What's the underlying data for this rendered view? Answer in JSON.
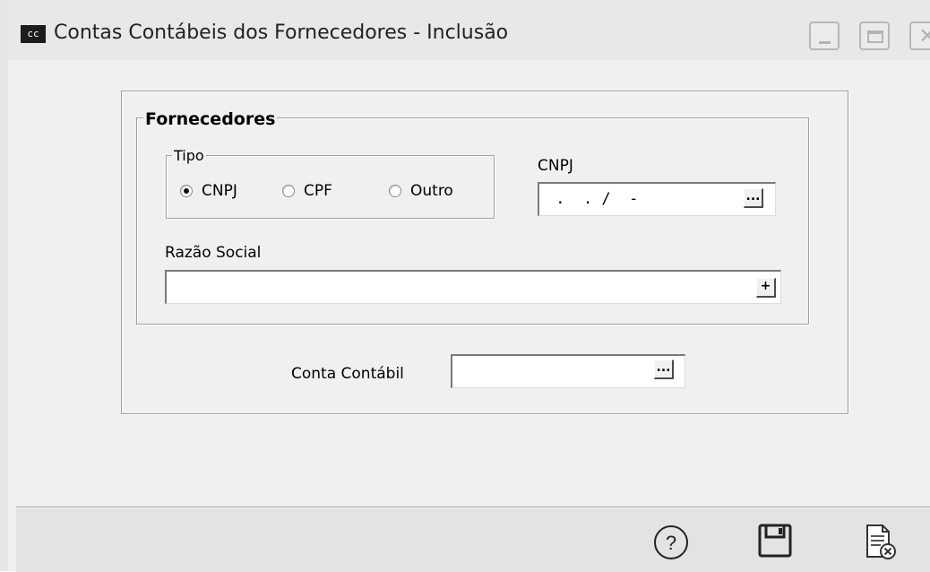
{
  "window": {
    "icon_text": "cc",
    "title": "Contas Contábeis dos Fornecedores - Inclusão"
  },
  "form": {
    "group_title": "Fornecedores",
    "tipo": {
      "title": "Tipo",
      "options": [
        "CNPJ",
        "CPF",
        "Outro"
      ],
      "selected": "CNPJ"
    },
    "cnpj": {
      "label": "CNPJ",
      "value": " .  . /  -",
      "button_label": "..."
    },
    "razao_social": {
      "label": "Razão Social",
      "value": "",
      "button_label": "+"
    },
    "conta_contabil": {
      "label": "Conta Contábil",
      "value": "",
      "button_label": "..."
    }
  },
  "toolbar": {
    "icons": [
      "help-icon",
      "save-icon",
      "cancel-document-icon"
    ]
  }
}
